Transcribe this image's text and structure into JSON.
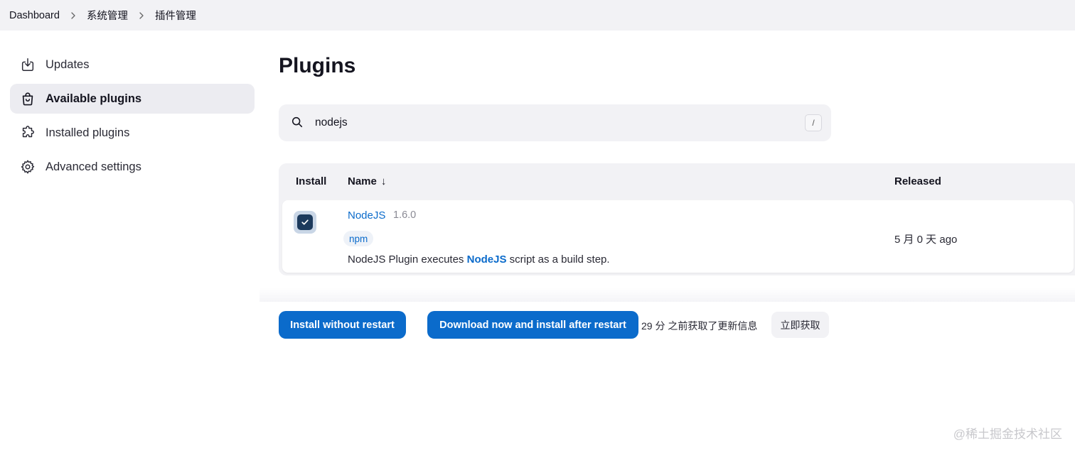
{
  "breadcrumb": {
    "items": [
      "Dashboard",
      "系统管理",
      "插件管理"
    ]
  },
  "sidebar": {
    "items": [
      {
        "label": "Updates",
        "icon": "download-icon",
        "active": false
      },
      {
        "label": "Available plugins",
        "icon": "shopping-bag-icon",
        "active": true
      },
      {
        "label": "Installed plugins",
        "icon": "puzzle-icon",
        "active": false
      },
      {
        "label": "Advanced settings",
        "icon": "gear-icon",
        "active": false
      }
    ]
  },
  "main": {
    "title": "Plugins",
    "search": {
      "value": "nodejs",
      "shortcut_key": "/"
    },
    "table": {
      "headers": {
        "install": "Install",
        "name": "Name",
        "name_sort_arrow": "↓",
        "released": "Released"
      },
      "rows": [
        {
          "checked": true,
          "name": "NodeJS",
          "version": "1.6.0",
          "tag": "npm",
          "description_prefix": "NodeJS Plugin executes ",
          "description_link": "NodeJS",
          "description_suffix": " script as a build step.",
          "released": "5 月 0 天 ago"
        }
      ]
    },
    "actions": {
      "install_without_restart": "Install without restart",
      "download_install_after_restart": "Download now and install after restart",
      "update_info": "29 分 之前获取了更新信息",
      "fetch_now": "立即获取"
    }
  },
  "watermark": "@稀土掘金技术社区",
  "colors": {
    "accent": "#0b6bcb",
    "topbar_bg": "#f2f2f5",
    "active_item_bg": "#ececf1",
    "checkbox_bg": "#1c3a5c"
  }
}
